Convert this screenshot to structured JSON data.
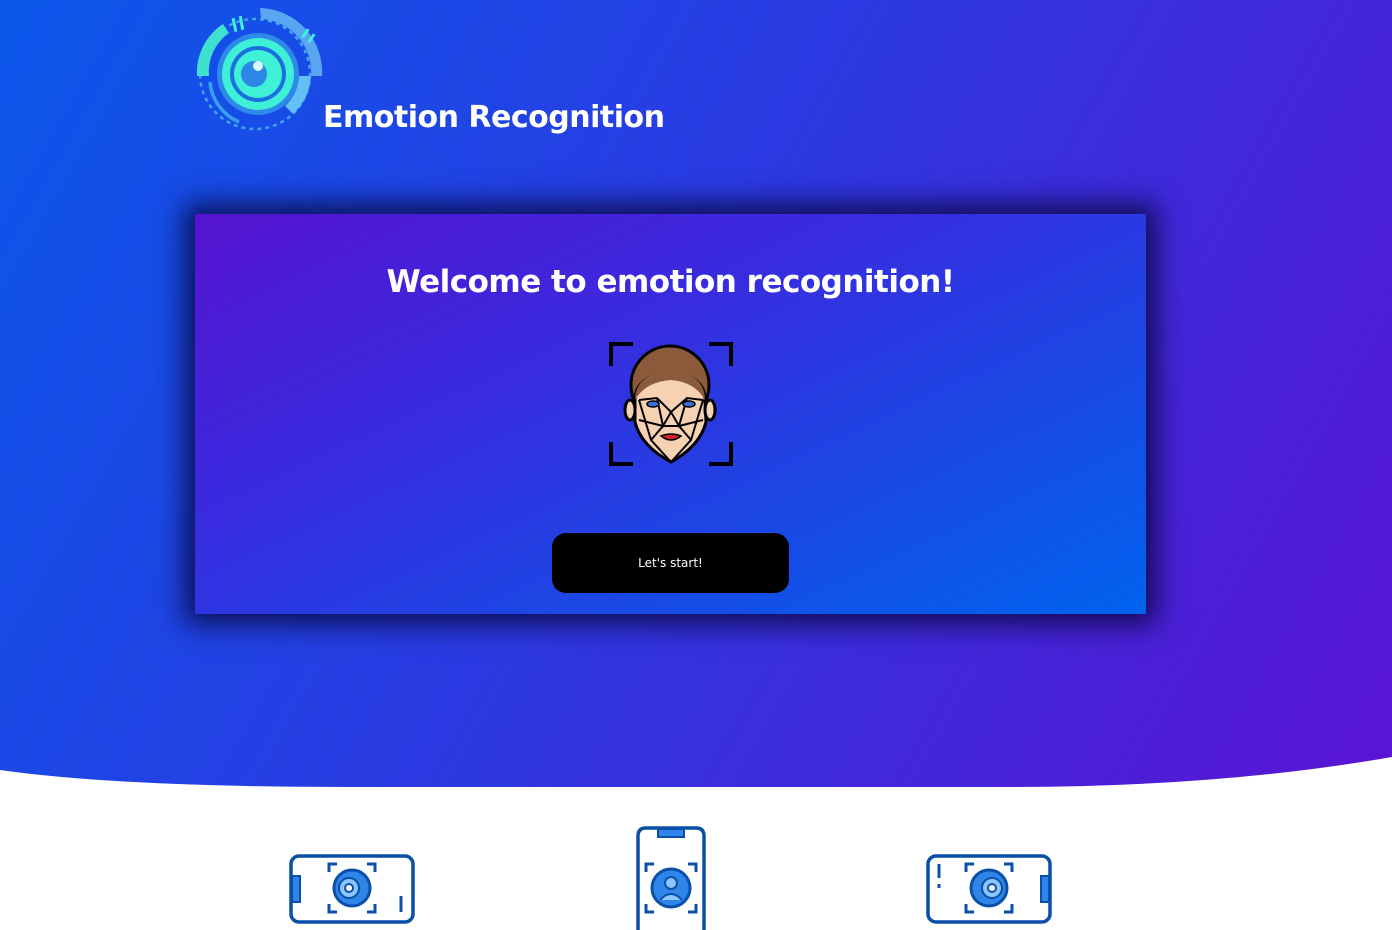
{
  "header": {
    "app_title": "Emotion Recognition",
    "logo_icon": "camera-lens-icon"
  },
  "welcome_card": {
    "heading": "Welcome to emotion recognition!",
    "illustration_icon": "face-scan-icon",
    "start_button_label": "Let's start!"
  },
  "features": [
    {
      "icon": "horizontal-phone-face-scan-icon"
    },
    {
      "icon": "vertical-phone-face-scan-icon"
    },
    {
      "icon": "horizontal-phone-face-scan-alert-icon"
    }
  ],
  "colors": {
    "hero_gradient_start": "#0b57ea",
    "hero_gradient_end": "#5a14d3",
    "card_gradient_start": "#5513cf",
    "card_gradient_end": "#0063ee",
    "button": "#000000",
    "logo_accent": "#3df2d8",
    "feature_icon_blue": "#0a4fa8"
  }
}
